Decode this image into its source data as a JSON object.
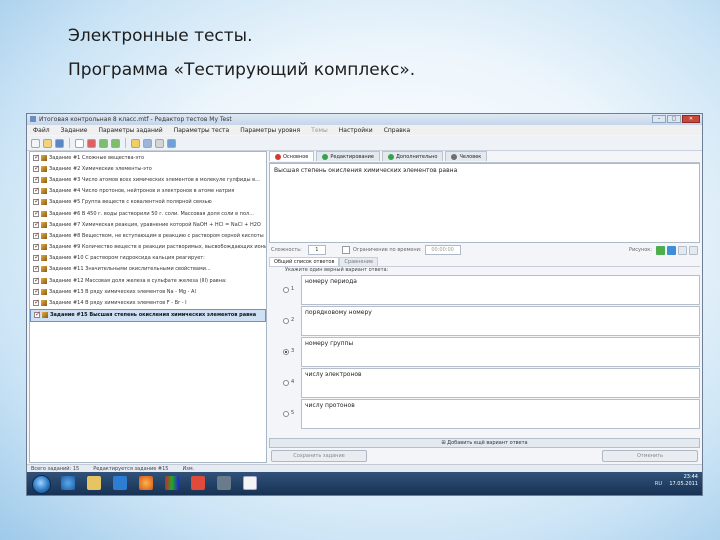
{
  "slide": {
    "title": "Электронные тесты.",
    "subtitle": "Программа «Тестирующий комплекс»."
  },
  "window": {
    "title": "Итоговая контрольная 8 класс.mtf - Редактор тестов My Test",
    "controls": [
      "–",
      "□",
      "✕"
    ]
  },
  "menu": [
    {
      "label": "Файл",
      "enabled": true
    },
    {
      "label": "Задание",
      "enabled": true
    },
    {
      "label": "Параметры заданий",
      "enabled": true
    },
    {
      "label": "Параметры теста",
      "enabled": true
    },
    {
      "label": "Параметры уровня",
      "enabled": true
    },
    {
      "label": "Темы",
      "enabled": false
    },
    {
      "label": "Настройки",
      "enabled": true
    },
    {
      "label": "Справка",
      "enabled": true
    }
  ],
  "tasks": [
    "Задание #1 Сложные вещества-это",
    "Задание #2 Химические элементы-это",
    "Задание #3 Число атомов всех химических элементов в молекуле  гулфиды в...",
    "Задание #4 Число протонов, нейтронов и электронов в атоме натрия",
    "Задание #5 Группа веществ с ковалентной полярной связью",
    "Задание #6 В 450 г. воды растворили 50 г. соли. Массовая доля соли в пол...",
    "Задание #7 Химическая реакция, уравнение которой NaOH + HCl = NaCl + H2O",
    "Задание #8 Веществом, не вступающим  в реакцию с раствором серной кислоты",
    "Задание #9 Количество  веществ  в реакции растворимых, высвобождающих  ионы",
    "Задание #10 С раствором гидроксида кальция реагирует:",
    "Задание #11 Значительными окислительными свойствами...",
    "Задание #12 Массовая доля железа в сульфате железа (III) равна:",
    "Задание #13 В ряду химических элементов  Na - Mg - Al",
    "Задание #14 В ряду химических элементов  F - Br - I",
    "Задание #15 Высшая степень окисления химических элементов равна"
  ],
  "selected_task_index": 14,
  "tabs": [
    {
      "label": "Основное",
      "color": "#d33c30"
    },
    {
      "label": "Редактирование",
      "color": "#3aa04a"
    },
    {
      "label": "Дополнительно",
      "color": "#3aa04a"
    },
    {
      "label": "Человек",
      "color": "#6f6f6f"
    }
  ],
  "question_text": "Высшая степень окисления химических элементов равна",
  "props": {
    "difficulty_label": "Сложность:",
    "difficulty_value": "1",
    "time_label": "Ограничение по времени:",
    "time_value": "00:00:00",
    "picture_label": "Рисунок:"
  },
  "subtabs": [
    "Общий список ответов",
    "Сравнение"
  ],
  "hint": "Укажите один верный вариант ответа:",
  "answers": [
    {
      "num": "1",
      "text": "номеру периода",
      "checked": false
    },
    {
      "num": "2",
      "text": "порядковому номеру",
      "checked": false
    },
    {
      "num": "3",
      "text": "номеру группы",
      "checked": true
    },
    {
      "num": "4",
      "text": "числу электронов",
      "checked": false
    },
    {
      "num": "5",
      "text": "числу протонов",
      "checked": false
    }
  ],
  "add_answer_label": "Добавить ещё вариант ответа",
  "buttons": {
    "save": "Сохранить задание",
    "cancel": "Отменить"
  },
  "status": {
    "total_tasks": "Всего заданий: 15",
    "edit_task": "Редактируется задание #15",
    "mode": "Изм."
  },
  "tray": {
    "lang": "RU",
    "time": "23:44",
    "date": "17.05.2011"
  }
}
